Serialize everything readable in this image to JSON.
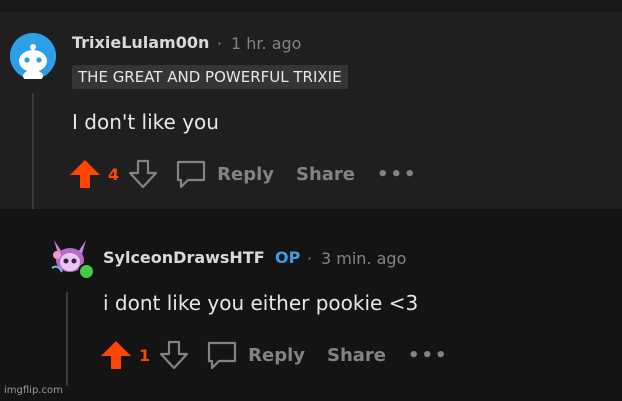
{
  "comments": [
    {
      "username": "TrixieLulam00n",
      "time": "1 hr. ago",
      "flair": "THE GREAT AND POWERFUL TRIXIE",
      "body": "I don't like you",
      "score": "4",
      "reply_label": "Reply",
      "share_label": "Share",
      "more_label": "•••"
    },
    {
      "username": "SylceonDrawsHTF",
      "op_badge": "OP",
      "time": "3 min. ago",
      "body": "i dont like you either pookie <3",
      "score": "1",
      "reply_label": "Reply",
      "share_label": "Share",
      "more_label": "•••"
    }
  ],
  "separator": "·",
  "watermark": "imgflip.com",
  "colors": {
    "upvote": "#ff4500",
    "op_badge": "#3d9ee8",
    "online": "#45c94a"
  },
  "icons": {
    "avatar1": "snoo-avatar-icon",
    "avatar2": "sylveon-avatar-icon",
    "upvote": "upvote-arrow-icon",
    "downvote": "downvote-arrow-icon",
    "reply": "speech-bubble-icon"
  }
}
